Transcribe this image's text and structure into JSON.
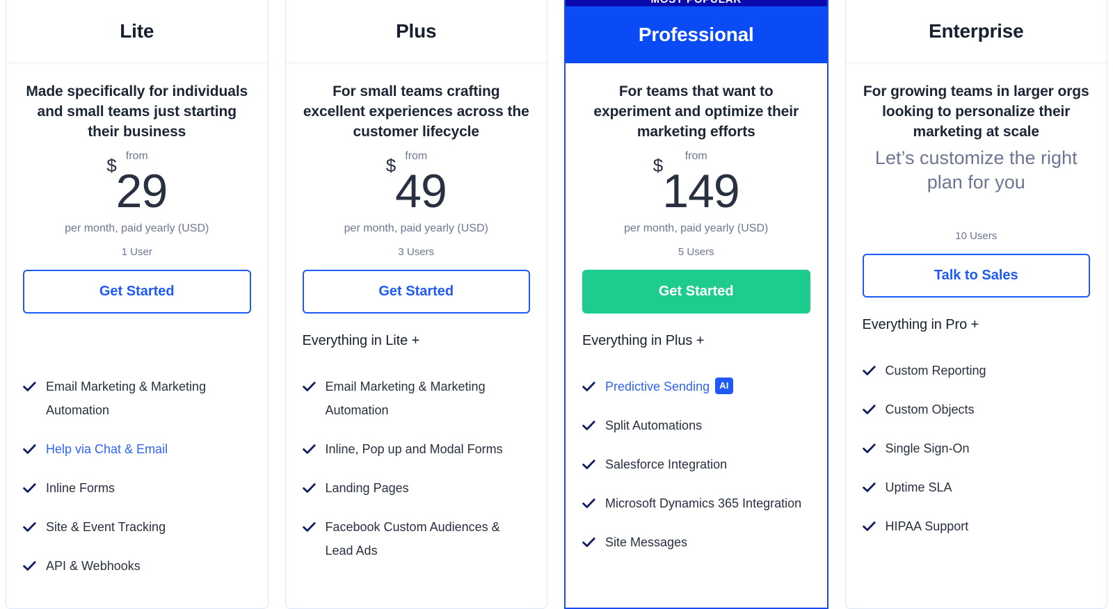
{
  "colors": {
    "brand_blue": "#1f59f7",
    "featured_header": "#0b4bf5",
    "popular_banner": "#0a0aae",
    "green_cta": "#1ecd8e",
    "check_navy": "#111c66",
    "muted_text": "#6d7690",
    "card_border": "#dbe3f7"
  },
  "plans": [
    {
      "name": "Lite",
      "featured": false,
      "description": "Made specifically for individuals and small teams just starting their business",
      "from_label": "from",
      "currency": "$",
      "price": "29",
      "price_note": "per month, paid yearly (USD)",
      "seats": "1 User",
      "cta_label": "Get Started",
      "cta_style": "outline",
      "everything_label": "",
      "features": [
        {
          "text": "Email Marketing & Marketing Automation",
          "link": false,
          "badge": null
        },
        {
          "text": "Help via Chat & Email",
          "link": true,
          "badge": null
        },
        {
          "text": "Inline Forms",
          "link": false,
          "badge": null
        },
        {
          "text": "Site & Event Tracking",
          "link": false,
          "badge": null
        },
        {
          "text": "API & Webhooks",
          "link": false,
          "badge": null
        }
      ]
    },
    {
      "name": "Plus",
      "featured": false,
      "description": "For small teams crafting excellent experiences across the customer lifecycle",
      "from_label": "from",
      "currency": "$",
      "price": "49",
      "price_note": "per month, paid yearly (USD)",
      "seats": "3 Users",
      "cta_label": "Get Started",
      "cta_style": "outline",
      "everything_label": "Everything in Lite +",
      "features": [
        {
          "text": "Email Marketing & Marketing Automation",
          "link": false,
          "badge": null
        },
        {
          "text": "Inline, Pop up and Modal Forms",
          "link": false,
          "badge": null
        },
        {
          "text": "Landing Pages",
          "link": false,
          "badge": null
        },
        {
          "text": "Facebook Custom Audiences & Lead Ads",
          "link": false,
          "badge": null
        }
      ]
    },
    {
      "name": "Professional",
      "featured": true,
      "popular_badge": "MOST POPULAR",
      "description": "For teams that want to experiment and optimize their marketing efforts",
      "from_label": "from",
      "currency": "$",
      "price": "149",
      "price_note": "per month, paid yearly (USD)",
      "seats": "5 Users",
      "cta_label": "Get Started",
      "cta_style": "solid",
      "everything_label": "Everything in Plus +",
      "features": [
        {
          "text": "Predictive Sending",
          "link": true,
          "badge": "AI"
        },
        {
          "text": "Split Automations",
          "link": false,
          "badge": null
        },
        {
          "text": "Salesforce Integration",
          "link": false,
          "badge": null
        },
        {
          "text": "Microsoft Dynamics 365 Integration",
          "link": false,
          "badge": null
        },
        {
          "text": "Site Messages",
          "link": false,
          "badge": null
        }
      ]
    },
    {
      "name": "Enterprise",
      "featured": false,
      "description": "For growing teams in larger orgs looking to personalize their marketing at scale",
      "custom_price": "Let’s customize the right plan for you",
      "seats": "10 Users",
      "cta_label": "Talk to Sales",
      "cta_style": "outline",
      "everything_label": "Everything in Pro +",
      "features": [
        {
          "text": "Custom Reporting",
          "link": false,
          "badge": null
        },
        {
          "text": "Custom Objects",
          "link": false,
          "badge": null
        },
        {
          "text": "Single Sign-On",
          "link": false,
          "badge": null
        },
        {
          "text": "Uptime SLA",
          "link": false,
          "badge": null
        },
        {
          "text": "HIPAA Support",
          "link": false,
          "badge": null
        }
      ]
    }
  ]
}
